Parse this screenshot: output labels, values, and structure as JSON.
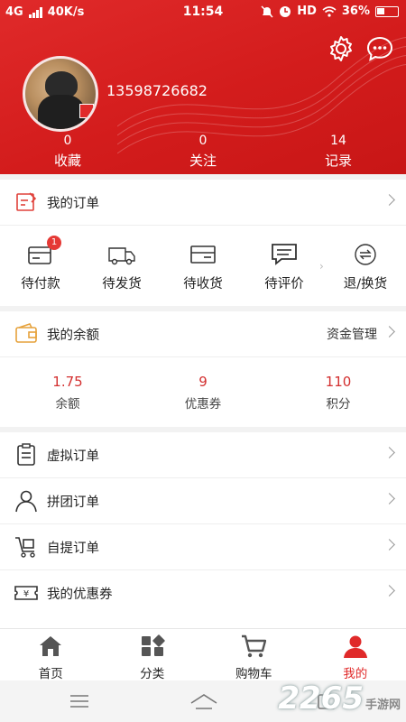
{
  "status_bar": {
    "network": "4G",
    "speed": "40K/s",
    "time": "11:54",
    "hd": "HD",
    "battery": "36%"
  },
  "profile": {
    "phone": "13598726682",
    "stats": [
      {
        "value": "0",
        "label": "收藏"
      },
      {
        "value": "0",
        "label": "关注"
      },
      {
        "value": "14",
        "label": "记录"
      }
    ]
  },
  "orders": {
    "title": "我的订单",
    "items": [
      {
        "label": "待付款",
        "badge": "1",
        "icon": "wallet-icon"
      },
      {
        "label": "待发货",
        "icon": "truck-icon"
      },
      {
        "label": "待收货",
        "icon": "box-icon"
      },
      {
        "label": "待评价",
        "icon": "comment-icon"
      },
      {
        "label": "退/换货",
        "icon": "exchange-icon"
      }
    ]
  },
  "balance": {
    "title": "我的余额",
    "manage": "资金管理",
    "items": [
      {
        "value": "1.75",
        "label": "余额"
      },
      {
        "value": "9",
        "label": "优惠券"
      },
      {
        "value": "110",
        "label": "积分"
      }
    ]
  },
  "menu": [
    {
      "label": "虚拟订单",
      "icon": "clipboard-icon"
    },
    {
      "label": "拼团订单",
      "icon": "user-icon"
    },
    {
      "label": "自提订单",
      "icon": "cart-box-icon"
    },
    {
      "label": "我的优惠券",
      "icon": "coupon-icon"
    }
  ],
  "tabbar": [
    {
      "label": "首页",
      "icon": "home-icon"
    },
    {
      "label": "分类",
      "icon": "category-icon"
    },
    {
      "label": "购物车",
      "icon": "cart-icon"
    },
    {
      "label": "我的",
      "icon": "profile-icon",
      "active": true
    }
  ],
  "watermark": {
    "brand": "2265",
    "site": "手游网"
  },
  "colors": {
    "accent": "#e02a2a",
    "value_red": "#d32f2f",
    "background": "#f2f2f2"
  }
}
